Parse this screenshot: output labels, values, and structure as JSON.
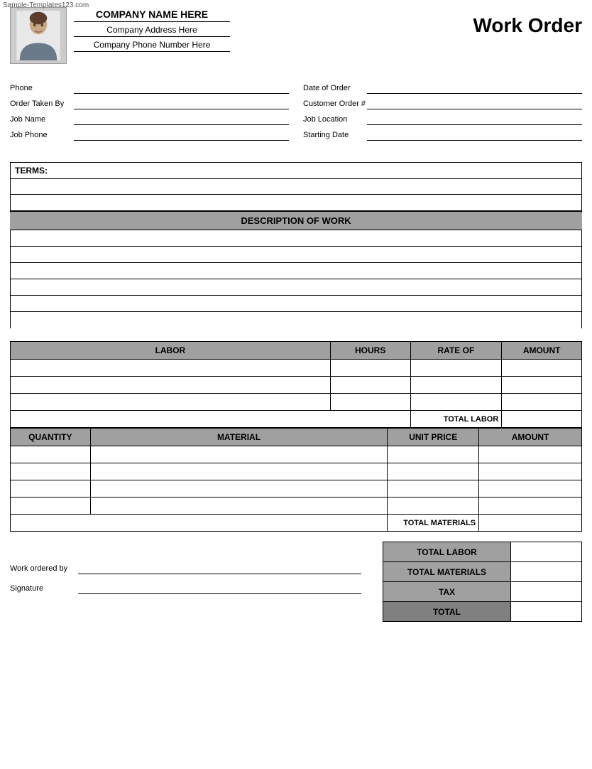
{
  "watermark": "Sample-Templates123.com",
  "header": {
    "company_name": "COMPANY NAME HERE",
    "company_address": "Company Address Here",
    "company_phone": "Company Phone Number Here",
    "title": "Work Order"
  },
  "form": {
    "left": [
      {
        "label": "Phone",
        "value": ""
      },
      {
        "label": "Order Taken By",
        "value": ""
      },
      {
        "label": "Job Name",
        "value": ""
      },
      {
        "label": "Job Phone",
        "value": ""
      }
    ],
    "right": [
      {
        "label": "Date of Order",
        "value": ""
      },
      {
        "label": "Customer Order #",
        "value": ""
      },
      {
        "label": "Job Location",
        "value": ""
      },
      {
        "label": "Starting Date",
        "value": ""
      }
    ]
  },
  "terms": {
    "label": "TERMS:"
  },
  "description": {
    "header": "DESCRIPTION OF WORK",
    "rows": 6
  },
  "labor": {
    "columns": [
      "LABOR",
      "HOURS",
      "RATE OF",
      "AMOUNT"
    ],
    "rows": 3,
    "total_label": "TOTAL LABOR"
  },
  "material": {
    "columns": [
      "QUANTITY",
      "MATERIAL",
      "UNIT PRICE",
      "AMOUNT"
    ],
    "rows": 4,
    "total_label": "TOTAL MATERIALS"
  },
  "totals": [
    {
      "label": "TOTAL LABOR",
      "value": ""
    },
    {
      "label": "TOTAL MATERIALS",
      "value": ""
    },
    {
      "label": "TAX",
      "value": ""
    },
    {
      "label": "TOTAL",
      "value": ""
    }
  ],
  "signature": {
    "work_ordered_by": "Work ordered by",
    "signature": "Signature"
  }
}
